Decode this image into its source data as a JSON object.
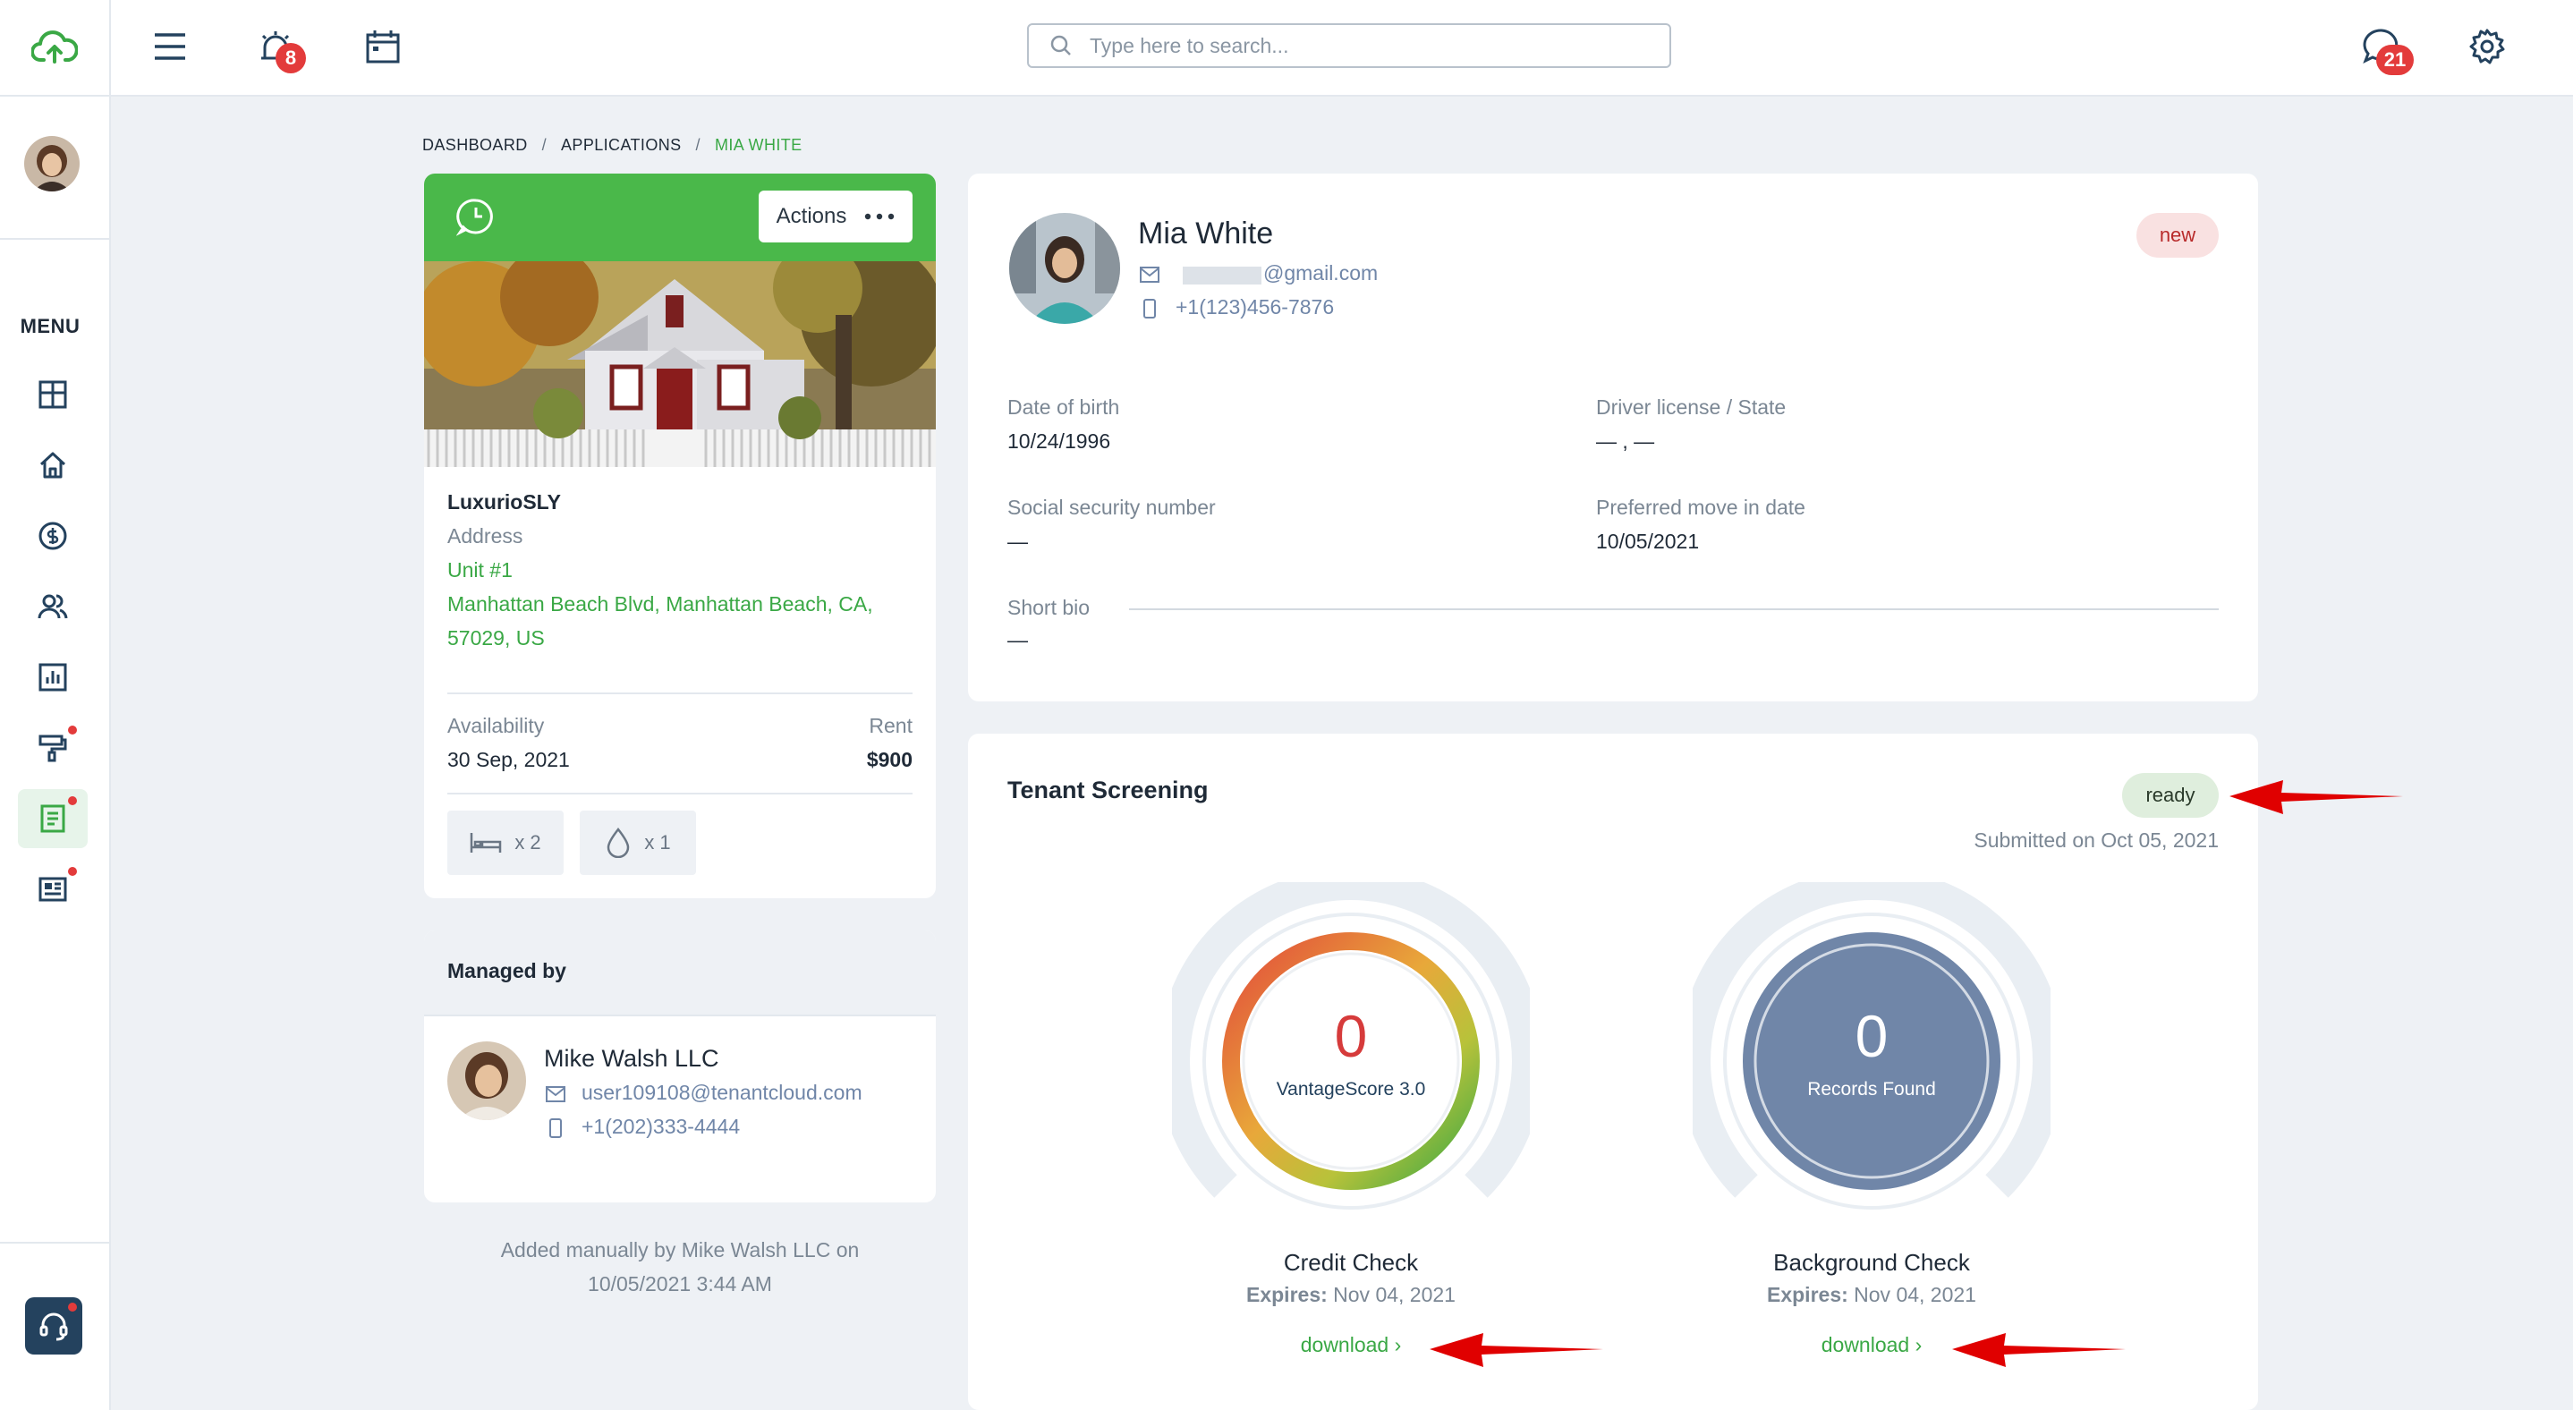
{
  "topbar": {
    "search_placeholder": "Type here to search...",
    "alerts_count": "8",
    "messages_count": "21"
  },
  "sidebar": {
    "menu_label": "MENU",
    "items": [
      "dashboard",
      "properties",
      "accounting",
      "people",
      "reports",
      "maintenance",
      "applications",
      "listings"
    ]
  },
  "breadcrumb": {
    "items": [
      "DASHBOARD",
      "APPLICATIONS",
      "MIA WHITE"
    ],
    "separator": "/"
  },
  "property": {
    "actions_label": "Actions",
    "name": "LuxurioSLY",
    "address_label": "Address",
    "unit": "Unit #1",
    "address_line1": "Manhattan Beach Blvd, Manhattan Beach, CA,",
    "address_line2": "57029, US",
    "availability_label": "Availability",
    "availability_value": "30 Sep, 2021",
    "rent_label": "Rent",
    "rent_value": "$900",
    "beds": "x 2",
    "baths": "x 1"
  },
  "managed": {
    "title": "Managed by",
    "name": "Mike Walsh LLC",
    "email": "user109108@tenantcloud.com",
    "phone": "+1(202)333-4444"
  },
  "footnote": {
    "line1": "Added manually by Mike Walsh LLC on",
    "line2": "10/05/2021 3:44 AM"
  },
  "applicant": {
    "name": "Mia White",
    "email": "@gmail.com",
    "phone": "+1(123)456-7876",
    "status": "new",
    "dob_label": "Date of birth",
    "dob_value": "10/24/1996",
    "license_label": "Driver license / State",
    "license_value": "— , —",
    "ssn_label": "Social security number",
    "ssn_value": "—",
    "move_label": "Preferred move in date",
    "move_value": "10/05/2021",
    "bio_label": "Short bio",
    "bio_value": "—"
  },
  "screening": {
    "title": "Tenant Screening",
    "status": "ready",
    "submitted": "Submitted on Oct 05, 2021",
    "credit": {
      "score": "0",
      "score_label": "VantageScore 3.0",
      "title": "Credit Check",
      "expires_label": "Expires:",
      "expires_value": "Nov 04, 2021",
      "download": "download ›"
    },
    "background": {
      "count": "0",
      "count_label": "Records Found",
      "title": "Background Check",
      "expires_label": "Expires:",
      "expires_value": "Nov 04, 2021",
      "download": "download ›"
    }
  },
  "colors": {
    "brand_green": "#4ab84a",
    "link_green": "#3aa845",
    "badge_red": "#e33b3b",
    "annotation_red": "#e00000",
    "records_blue": "#7086a8"
  }
}
